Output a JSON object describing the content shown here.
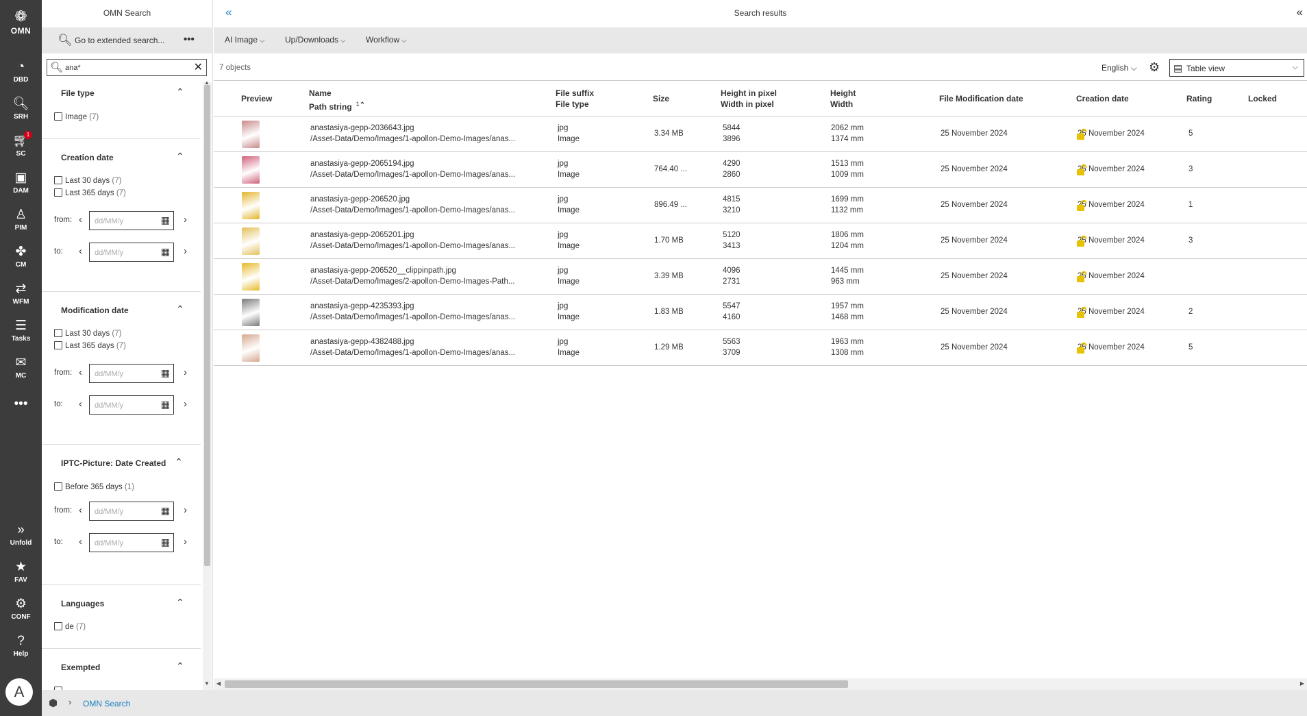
{
  "rail": {
    "logo": "OMN",
    "items": [
      {
        "icon": "speedometer-icon",
        "label": "DBD"
      },
      {
        "icon": "search-icon",
        "label": "SRH"
      },
      {
        "icon": "cart-icon",
        "label": "SC",
        "badge": "1"
      },
      {
        "icon": "image-icon",
        "label": "DAM"
      },
      {
        "icon": "product-icon",
        "label": "PIM"
      },
      {
        "icon": "network-icon",
        "label": "CM"
      },
      {
        "icon": "workflow-icon",
        "label": "WFM"
      },
      {
        "icon": "tasks-icon",
        "label": "Tasks"
      },
      {
        "icon": "mail-icon",
        "label": "MC"
      }
    ],
    "bottom": [
      {
        "icon": "double-chevron-right-icon",
        "label": "Unfold"
      },
      {
        "icon": "star-icon",
        "label": "FAV"
      },
      {
        "icon": "gear-icon",
        "label": "CONF"
      },
      {
        "icon": "question-icon",
        "label": "Help"
      }
    ],
    "avatar": "A"
  },
  "panel": {
    "title": "OMN Search",
    "extended_search": "Go to extended search...",
    "query": "ana*",
    "facets": {
      "file_type": {
        "title": "File type",
        "options": [
          {
            "label": "Image",
            "count": "(7)"
          }
        ]
      },
      "creation_date": {
        "title": "Creation date",
        "options": [
          {
            "label": "Last 30 days",
            "count": "(7)"
          },
          {
            "label": "Last 365 days",
            "count": "(7)"
          }
        ]
      },
      "modification_date": {
        "title": "Modification date",
        "options": [
          {
            "label": "Last 30 days",
            "count": "(7)"
          },
          {
            "label": "Last 365 days",
            "count": "(7)"
          }
        ]
      },
      "iptc": {
        "title": "IPTC-Picture: Date Created",
        "options": [
          {
            "label": "Before 365 days",
            "count": "(1)"
          }
        ]
      },
      "languages": {
        "title": "Languages",
        "options": [
          {
            "label": "de",
            "count": "(7)"
          }
        ]
      },
      "exempted": {
        "title": "Exempted"
      }
    },
    "from_label": "from:",
    "to_label": "to:",
    "date_placeholder": "dd/MM/y"
  },
  "main": {
    "title": "Search results",
    "menus": [
      "AI Image",
      "Up/Downloads",
      "Workflow"
    ],
    "object_count": "7 objects",
    "language": "English",
    "view": "Table view"
  },
  "table": {
    "headers": {
      "preview": "Preview",
      "name": "Name",
      "path": "Path string",
      "sort_index": "1",
      "suffix": "File suffix",
      "filetype": "File type",
      "size": "Size",
      "height_px": "Height in pixel",
      "width_px": "Width in pixel",
      "height": "Height",
      "width": "Width",
      "moddate": "File Modification date",
      "created": "Creation date",
      "rating": "Rating",
      "locked": "Locked"
    },
    "rows": [
      {
        "name": "anastasiya-gepp-2036643.jpg",
        "path": "/Asset-Data/Demo/Images/1-apollon-Demo-Images/anas...",
        "suffix": "jpg",
        "type": "Image",
        "size": "3.34 MB",
        "hpx": "5844",
        "wpx": "3896",
        "h": "2062 mm",
        "w": "1374 mm",
        "mod": "25 November 2024",
        "created": "25 November 2024",
        "rating": "5",
        "thumb": "#c98a8a"
      },
      {
        "name": "anastasiya-gepp-2065194.jpg",
        "path": "/Asset-Data/Demo/Images/1-apollon-Demo-Images/anas...",
        "suffix": "jpg",
        "type": "Image",
        "size": "764.40 ...",
        "hpx": "4290",
        "wpx": "2860",
        "h": "1513 mm",
        "w": "1009 mm",
        "mod": "25 November 2024",
        "created": "25 November 2024",
        "rating": "3",
        "thumb": "#d0607a"
      },
      {
        "name": "anastasiya-gepp-206520.jpg",
        "path": "/Asset-Data/Demo/Images/1-apollon-Demo-Images/anas...",
        "suffix": "jpg",
        "type": "Image",
        "size": "896.49 ...",
        "hpx": "4815",
        "wpx": "3210",
        "h": "1699 mm",
        "w": "1132 mm",
        "mod": "25 November 2024",
        "created": "25 November 2024",
        "rating": "1",
        "thumb": "#e2b52c"
      },
      {
        "name": "anastasiya-gepp-2065201.jpg",
        "path": "/Asset-Data/Demo/Images/1-apollon-Demo-Images/anas...",
        "suffix": "jpg",
        "type": "Image",
        "size": "1.70 MB",
        "hpx": "5120",
        "wpx": "3413",
        "h": "1806 mm",
        "w": "1204 mm",
        "mod": "25 November 2024",
        "created": "25 November 2024",
        "rating": "3",
        "thumb": "#e4c05a"
      },
      {
        "name": "anastasiya-gepp-206520__clippinpath.jpg",
        "path": "/Asset-Data/Demo/Images/2-apollon-Demo-Images-Path...",
        "suffix": "jpg",
        "type": "Image",
        "size": "3.39 MB",
        "hpx": "4096",
        "wpx": "2731",
        "h": "1445 mm",
        "w": "963 mm",
        "mod": "25 November 2024",
        "created": "25 November 2024",
        "rating": "",
        "thumb": "#e6bb2a"
      },
      {
        "name": "anastasiya-gepp-4235393.jpg",
        "path": "/Asset-Data/Demo/Images/1-apollon-Demo-Images/anas...",
        "suffix": "jpg",
        "type": "Image",
        "size": "1.83 MB",
        "hpx": "5547",
        "wpx": "4160",
        "h": "1957 mm",
        "w": "1468 mm",
        "mod": "25 November 2024",
        "created": "25 November 2024",
        "rating": "2",
        "thumb": "#7a7a7a"
      },
      {
        "name": "anastasiya-gepp-4382488.jpg",
        "path": "/Asset-Data/Demo/Images/1-apollon-Demo-Images/anas...",
        "suffix": "jpg",
        "type": "Image",
        "size": "1.29 MB",
        "hpx": "5563",
        "wpx": "3709",
        "h": "1963 mm",
        "w": "1308 mm",
        "mod": "25 November 2024",
        "created": "25 November 2024",
        "rating": "5",
        "thumb": "#d6a890"
      }
    ]
  },
  "footer": {
    "crumb": "OMN Search"
  },
  "colors": {
    "accent": "#1a7fc1",
    "lock": "#e6c200",
    "rail": "#3c3c3c",
    "badge": "#d0021b"
  }
}
